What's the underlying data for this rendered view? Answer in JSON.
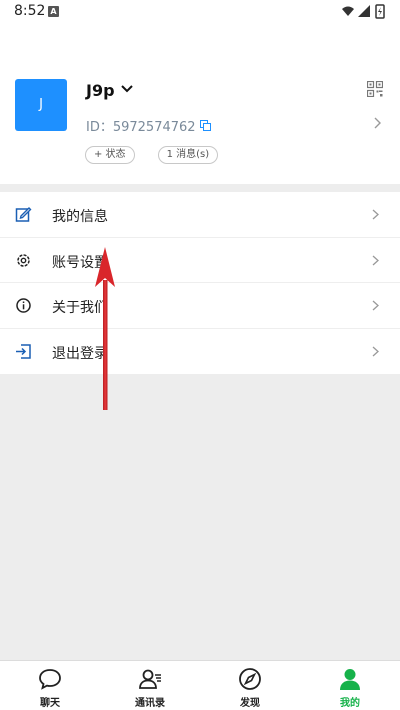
{
  "status_bar": {
    "time": "8:52",
    "notification_badge": "A"
  },
  "profile": {
    "avatar_letter": "J",
    "name": "J9p",
    "id_text": "ID：5972574762",
    "chips": [
      "+ 状态",
      "1 消息(s)"
    ]
  },
  "menu": {
    "items": [
      {
        "label": "我的信息",
        "icon": "edit-icon"
      },
      {
        "label": "账号设置",
        "icon": "gear-icon"
      },
      {
        "label": "关于我们",
        "icon": "info-icon"
      },
      {
        "label": "退出登录",
        "icon": "logout-icon"
      }
    ]
  },
  "tabbar": {
    "tabs": [
      {
        "label": "聊天",
        "icon": "chat-bubble-icon"
      },
      {
        "label": "通讯录",
        "icon": "contacts-icon"
      },
      {
        "label": "发现",
        "icon": "compass-icon"
      },
      {
        "label": "我的",
        "icon": "person-icon",
        "active": true
      }
    ]
  },
  "colors": {
    "avatar_bg": "#1e90ff",
    "active_tab": "#16b24a",
    "annotation_arrow": "#d9262b"
  }
}
